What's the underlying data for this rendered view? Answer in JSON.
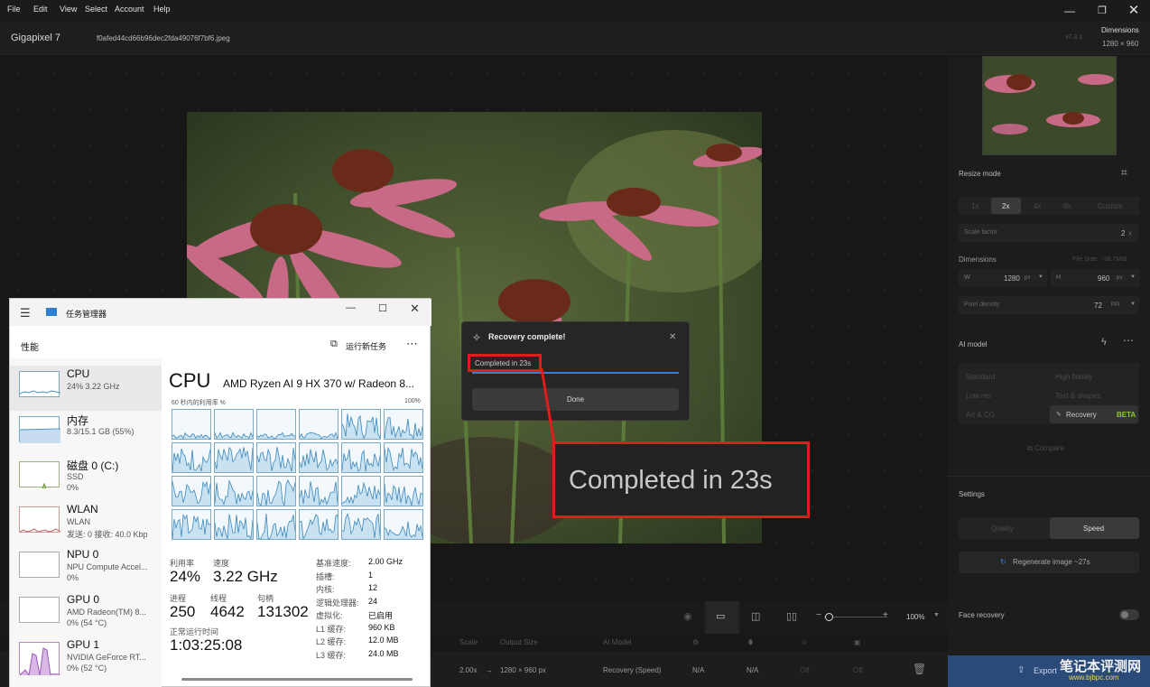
{
  "menu": [
    "File",
    "Edit",
    "View",
    "Select",
    "Account",
    "Help"
  ],
  "app": {
    "name": "Gigapixel",
    "version_num": "7",
    "filename": "f0afed44cd66b96dec2fda49076f7bf6.jpeg",
    "build": "v7.3.1",
    "dimensions_label": "Dimensions",
    "dimensions_value": "1280 × 960"
  },
  "right_panel": {
    "resize_mode": "Resize mode",
    "scales": [
      "1x",
      "2x",
      "4x",
      "6x",
      "Custom"
    ],
    "scale_factor_label": "Scale factor",
    "scale_factor_value": "2",
    "dimensions_label": "Dimensions",
    "file_size": "File Size: ~38.7MiB",
    "w_label": "W",
    "w_value": "1280",
    "w_unit": "px",
    "h_label": "H",
    "h_value": "960",
    "h_unit": "px",
    "pixel_density_label": "Pixel density",
    "pixel_density_value": "72",
    "pixel_density_unit": "PPI",
    "ai_model_label": "AI model",
    "models": [
      "Standard",
      "High fidelity",
      "Low res",
      "Text & shapes",
      "Art & CG",
      "Recovery"
    ],
    "beta": "BETA",
    "compare": "Compare",
    "settings_label": "Settings",
    "quality": "Quality",
    "speed": "Speed",
    "regenerate": "Regenerate image ~27s",
    "face_recovery": "Face recovery",
    "export": "Export"
  },
  "toolbar": {
    "zoom": "100%"
  },
  "table": {
    "headers": [
      "Scale",
      "Output Size",
      "AI Model"
    ],
    "row": {
      "scale": "2.00x",
      "arrow": "→",
      "output": "1280 × 960 px",
      "model": "Recovery (Speed)",
      "na1": "N/A",
      "na2": "N/A",
      "off1": "Off",
      "off2": "Off"
    }
  },
  "dialog": {
    "title": "Recovery complete!",
    "status": "Completed in 23s",
    "done": "Done",
    "callout": "Completed in 23s"
  },
  "taskmgr": {
    "title": "任务管理器",
    "section": "性能",
    "run_new_task": "运行新任务",
    "sidebar": [
      {
        "name": "CPU",
        "sub1": "24%  3.22 GHz",
        "sub2": ""
      },
      {
        "name": "内存",
        "sub1": "8.3/15.1 GB (55%)",
        "sub2": ""
      },
      {
        "name": "磁盘 0 (C:)",
        "sub1": "SSD",
        "sub2": "0%"
      },
      {
        "name": "WLAN",
        "sub1": "WLAN",
        "sub2": "发送: 0 接收: 40.0 Kbp"
      },
      {
        "name": "NPU 0",
        "sub1": "NPU Compute Accel...",
        "sub2": "0%"
      },
      {
        "name": "GPU 0",
        "sub1": "AMD Radeon(TM) 8...",
        "sub2": "0% (54 °C)"
      },
      {
        "name": "GPU 1",
        "sub1": "NVIDIA GeForce RT...",
        "sub2": "0% (52 °C)"
      }
    ],
    "cpu_title": "CPU",
    "cpu_model": "AMD Ryzen AI 9 HX 370 w/ Radeon 8...",
    "util_caption": "60 秒内的利用率 %",
    "util_max": "100%",
    "stats": {
      "util_label": "利用率",
      "util_value": "24%",
      "speed_label": "速度",
      "speed_value": "3.22 GHz",
      "proc_label": "进程",
      "proc_value": "250",
      "thread_label": "线程",
      "thread_value": "4642",
      "handle_label": "句柄",
      "handle_value": "131302",
      "uptime_label": "正常运行时间",
      "uptime_value": "1:03:25:08"
    },
    "right_stats": [
      {
        "k": "基准速度:",
        "v": "2.00 GHz"
      },
      {
        "k": "插槽:",
        "v": "1"
      },
      {
        "k": "内核:",
        "v": "12"
      },
      {
        "k": "逻辑处理器:",
        "v": "24"
      },
      {
        "k": "虚拟化:",
        "v": "已启用"
      },
      {
        "k": "L1 缓存:",
        "v": "960 KB"
      },
      {
        "k": "L2 缓存:",
        "v": "12.0 MB"
      },
      {
        "k": "L3 缓存:",
        "v": "24.0 MB"
      }
    ]
  },
  "watermark": {
    "line1": "笔记本评测网",
    "line2": "www.bjbpc.com"
  }
}
